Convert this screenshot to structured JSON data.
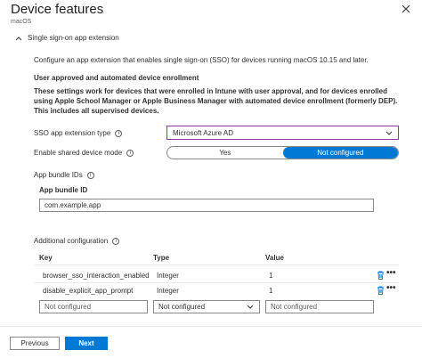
{
  "header": {
    "title": "Device features",
    "subtitle": "macOS"
  },
  "section": {
    "label": "Single sign-on app extension"
  },
  "description": "Configure an app extension that enables single sign-on (SSO) for devices running macOS 10.15 and later.",
  "enrollment": {
    "heading": "User approved and automated device enrollment",
    "note": "These settings work for devices that were enrolled in Intune with user approval, and for devices enrolled using Apple School Manager or Apple Business Manager with automated device enrollment (formerly DEP). This includes all supervised devices."
  },
  "sso_type": {
    "label": "SSO app extension type",
    "value": "Microsoft Azure AD"
  },
  "shared_mode": {
    "label": "Enable shared device mode",
    "option_yes": "Yes",
    "option_not_configured": "Not configured",
    "selected": "Not configured"
  },
  "bundle": {
    "section_label": "App bundle IDs",
    "field_label": "App bundle ID",
    "value": "com.example.app"
  },
  "additional": {
    "label": "Additional configuration",
    "columns": [
      "Key",
      "Type",
      "Value"
    ],
    "rows": [
      {
        "key": "browser_sso_interaction_enabled",
        "type": "Integer",
        "value": "1"
      },
      {
        "key": "disable_explicit_app_prompt",
        "type": "Integer",
        "value": "1"
      }
    ],
    "new_row": {
      "key_placeholder": "Not configured",
      "type_value": "Not configured",
      "value_placeholder": "Not configured"
    }
  },
  "footer": {
    "previous": "Previous",
    "next": "Next"
  },
  "colors": {
    "accent": "#0078d4",
    "focus_border": "#8a3a9e",
    "delete_icon": "#0078d4"
  },
  "icons": [
    "close-icon",
    "chevron-up-icon",
    "info-icon",
    "chevron-down-icon",
    "trash-icon",
    "more-icon"
  ]
}
